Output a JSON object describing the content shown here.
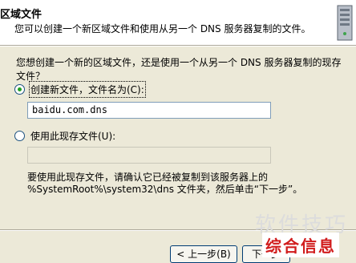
{
  "header": {
    "title": "区域文件",
    "subtitle": "您可以创建一个新区域文件和使用从另一个 DNS 服务器复制的文件。",
    "icon": "server-icon"
  },
  "main": {
    "question": "您想创建一个新的区域文件，还是使用一个从另一个 DNS 服务器复制的现存文件？",
    "option_new": {
      "label": "创建新文件，文件名为(C):",
      "selected": true,
      "filename_value": "baidu.com.dns"
    },
    "option_existing": {
      "label": "使用此现存文件(U):",
      "selected": false,
      "filename_value": ""
    },
    "note_line1": "要使用此现存文件，请确认它已经被复制到该服务器上的",
    "note_line2": "%SystemRoot%\\system32\\dns 文件夹，然后单击“下一步”。"
  },
  "footer": {
    "back_label": "< 上一步(B)",
    "next_label": "下一步"
  },
  "watermark": {
    "top_text": "软件技巧",
    "bottom_text": "综合信息"
  },
  "colors": {
    "dialog_bg": "#ece9d8",
    "header_bg": "#ffffff",
    "radio_dot": "#21a121",
    "watermark_red": "#d11c1c"
  }
}
